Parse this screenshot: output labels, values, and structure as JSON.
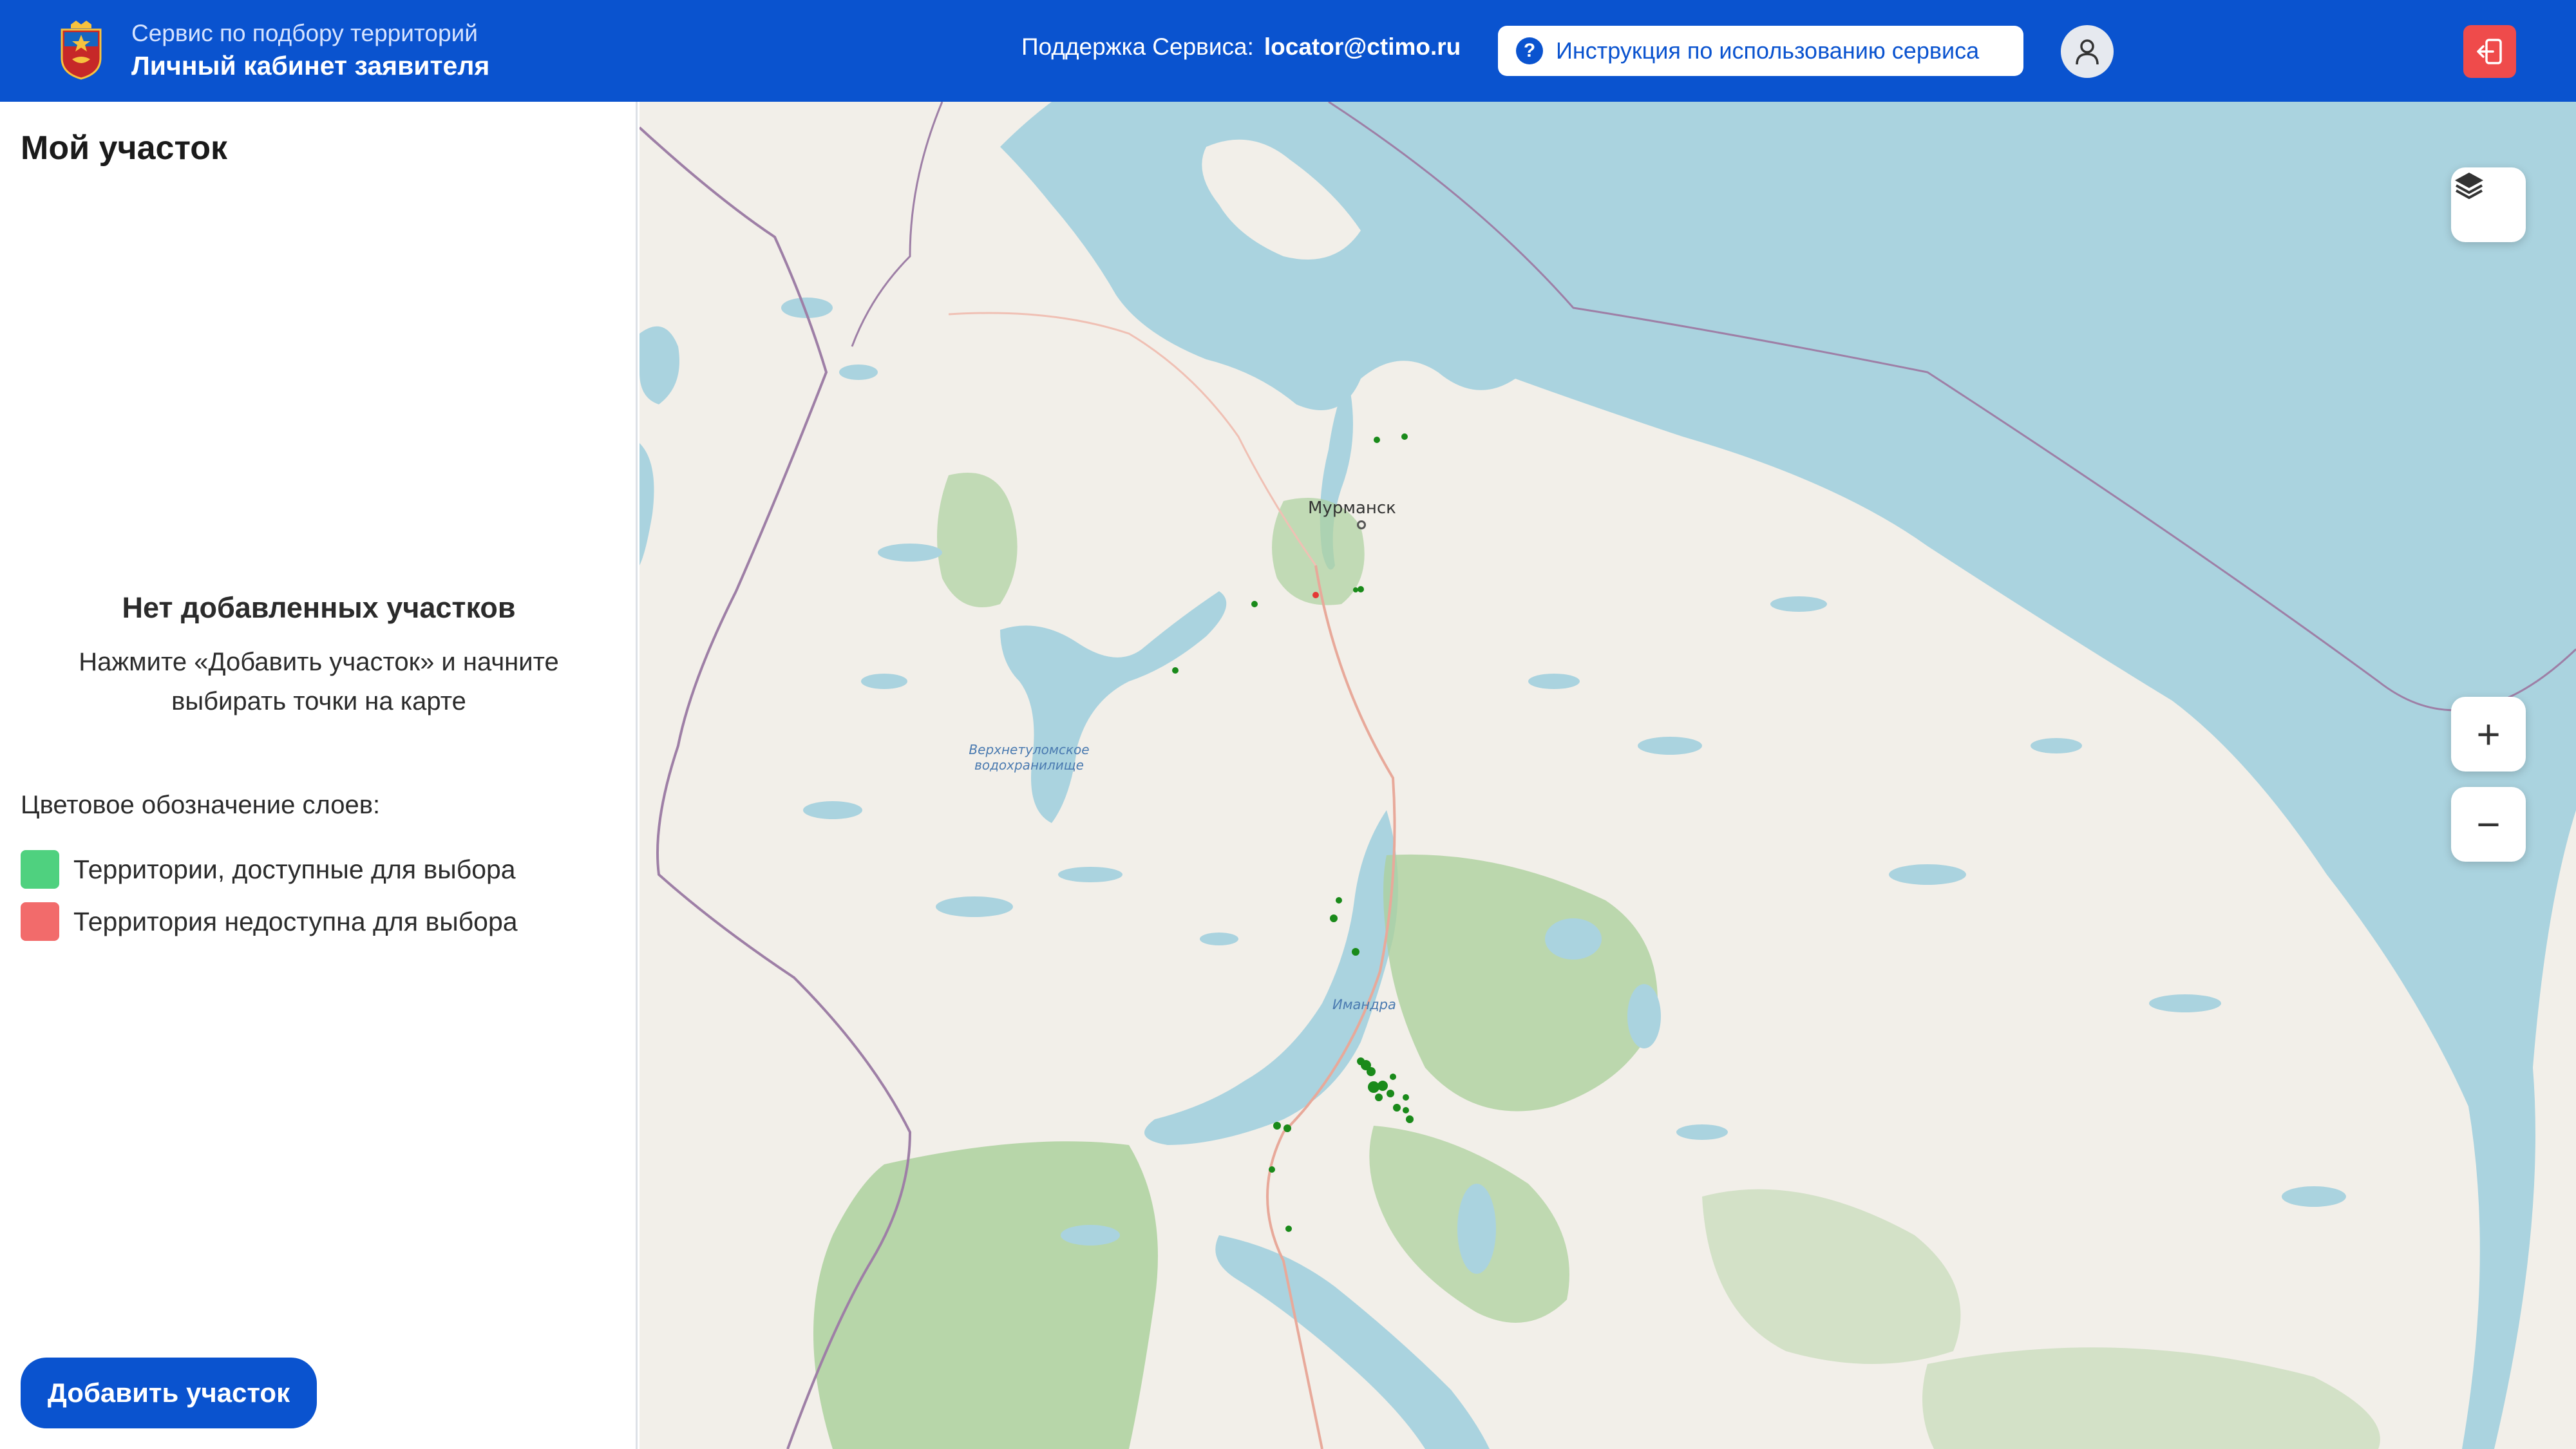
{
  "header": {
    "service_subtitle": "Сервис по подбору территорий",
    "service_title": "Личный кабинет заявителя",
    "support_label": "Поддержка Сервиса:",
    "support_email": "locator@ctimo.ru",
    "guide_button_label": "Инструкция по использованию сервиса",
    "guide_icon_glyph": "?",
    "accent_color": "#0a53cf"
  },
  "sidebar": {
    "title": "Мой участок",
    "empty_title": "Нет добавленных участков",
    "empty_text": "Нажмите «Добавить участок» и начните выбирать точки на карте",
    "legend_title": "Цветовое обозначение слоев:",
    "legend": [
      {
        "label": "Территории, доступные для выбора",
        "color": "#4fd17f"
      },
      {
        "label": "Территория недоступна для выбора",
        "color": "#f26b6b"
      }
    ],
    "add_button_label": "Добавить участок"
  },
  "map": {
    "labels": {
      "city": "Мурманск",
      "reservoir": "Верхнетуломское водохранилище",
      "lake": "Имандра"
    },
    "controls": {
      "zoom_in_glyph": "+",
      "zoom_out_glyph": "−",
      "layers_icon": "layers-icon"
    },
    "colors": {
      "land": "#f2efe9",
      "water": "#aad3df",
      "forest": "#add19e",
      "border": "#9e7fa6",
      "available_plot": "#1a8a1a",
      "unavailable_plot": "#e53935"
    }
  }
}
